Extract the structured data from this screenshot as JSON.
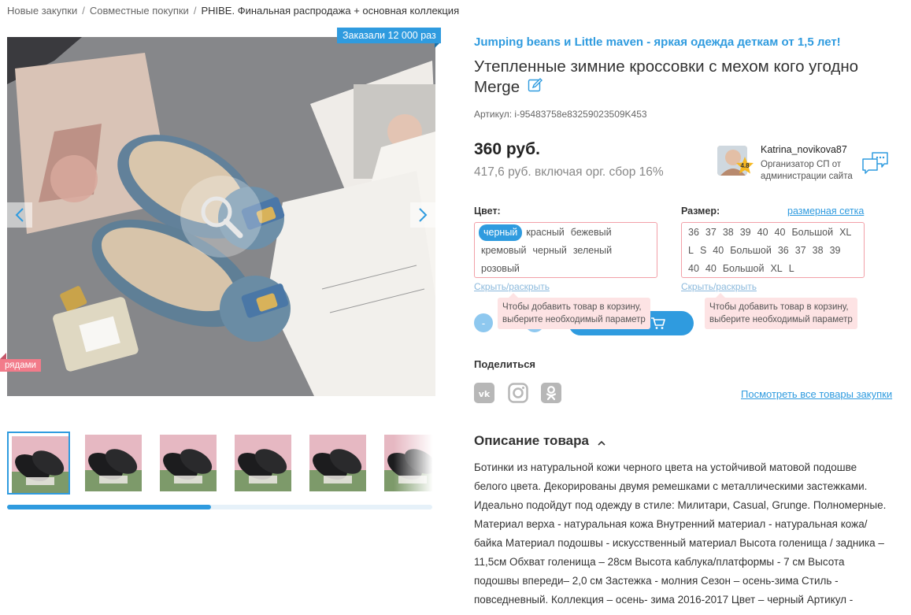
{
  "breadcrumb": {
    "items": [
      "Новые закупки",
      "Совместные покупки",
      "PHIBE. Финальная распродажа + основная коллекция"
    ],
    "separator": "/"
  },
  "gallery": {
    "ordered_badge": "Заказали 12 000 раз",
    "ryadami_badge": "рядами",
    "thumbnail_count": 6,
    "active_thumbnail": 0,
    "scroll_fraction": 0.48
  },
  "product": {
    "promo": "Jumping beans и Little maven - яркая одежда деткам от 1,5 лет!",
    "title": "Утепленные зимние кроссовки с мехом кого угодно Merge",
    "article": "Артикул: i-95483758e83259023509K453",
    "price": "360 руб.",
    "price_fee": "417,6 руб. включая орг. сбор 16%"
  },
  "organizer": {
    "name": "Katrina_novikova87",
    "rating": "4.8",
    "description": "Организатор СП от администрации сайта"
  },
  "color": {
    "label": "Цвет:",
    "options": [
      "черный",
      "красный",
      "бежевый",
      "кремовый",
      "черный",
      "зеленый",
      "розовый"
    ],
    "selected_index": 0,
    "toggle": "Скрыть/раскрыть",
    "tooltip_line1": "Чтобы добавить товар в корзину,",
    "tooltip_line2": "выберите необходимый параметр"
  },
  "size": {
    "label": "Размер:",
    "chart_link": "размерная сетка",
    "options": [
      "36",
      "37",
      "38",
      "39",
      "40",
      "40",
      "Большой",
      "XL",
      "L",
      "S",
      "40",
      "Большой",
      "36",
      "37",
      "38",
      "39",
      "40",
      "40",
      "Большой",
      "XL",
      "L"
    ],
    "toggle": "Скрыть/раскрыть",
    "tooltip_line1": "Чтобы добавить товар в корзину,",
    "tooltip_line2": "выберите необходимый параметр"
  },
  "quantity": {
    "minus": "-"
  },
  "share": {
    "label": "Поделиться",
    "networks": [
      "vk-icon",
      "instagram-icon",
      "odnoklassniki-icon"
    ],
    "all_goods_link": "Посмотреть все товары закупки"
  },
  "description": {
    "title": "Описание товара",
    "text": "Ботинки из натуральной кожи черного цвета на устойчивой матовой подошве белого цвета. Декорированы двумя ремешками с металлическими застежками. Идеально подойдут под одежду в стиле: Милитари, Casual, Grunge. Полномерные. Материал верха - натуральная кожа Внутренний материал - натуральная кожа/байка Материал подошвы - искусственный материал Высота голенища / задника – 11,5см Обхват голенища – 28см Высота каблука/платформы - 7 см Высота подошвы впереди– 2,0 см Застежка - молния Сезон – осень-зима Стиль - повседневный. Коллекция – осень- зима 2016-2017 Цвет – черный Артикул -"
  },
  "colors": {
    "accent": "#2f9bdf",
    "warning_border": "#f2a0a8",
    "tooltip_bg": "#fde3e4",
    "badge_pink": "#f27b8a"
  }
}
